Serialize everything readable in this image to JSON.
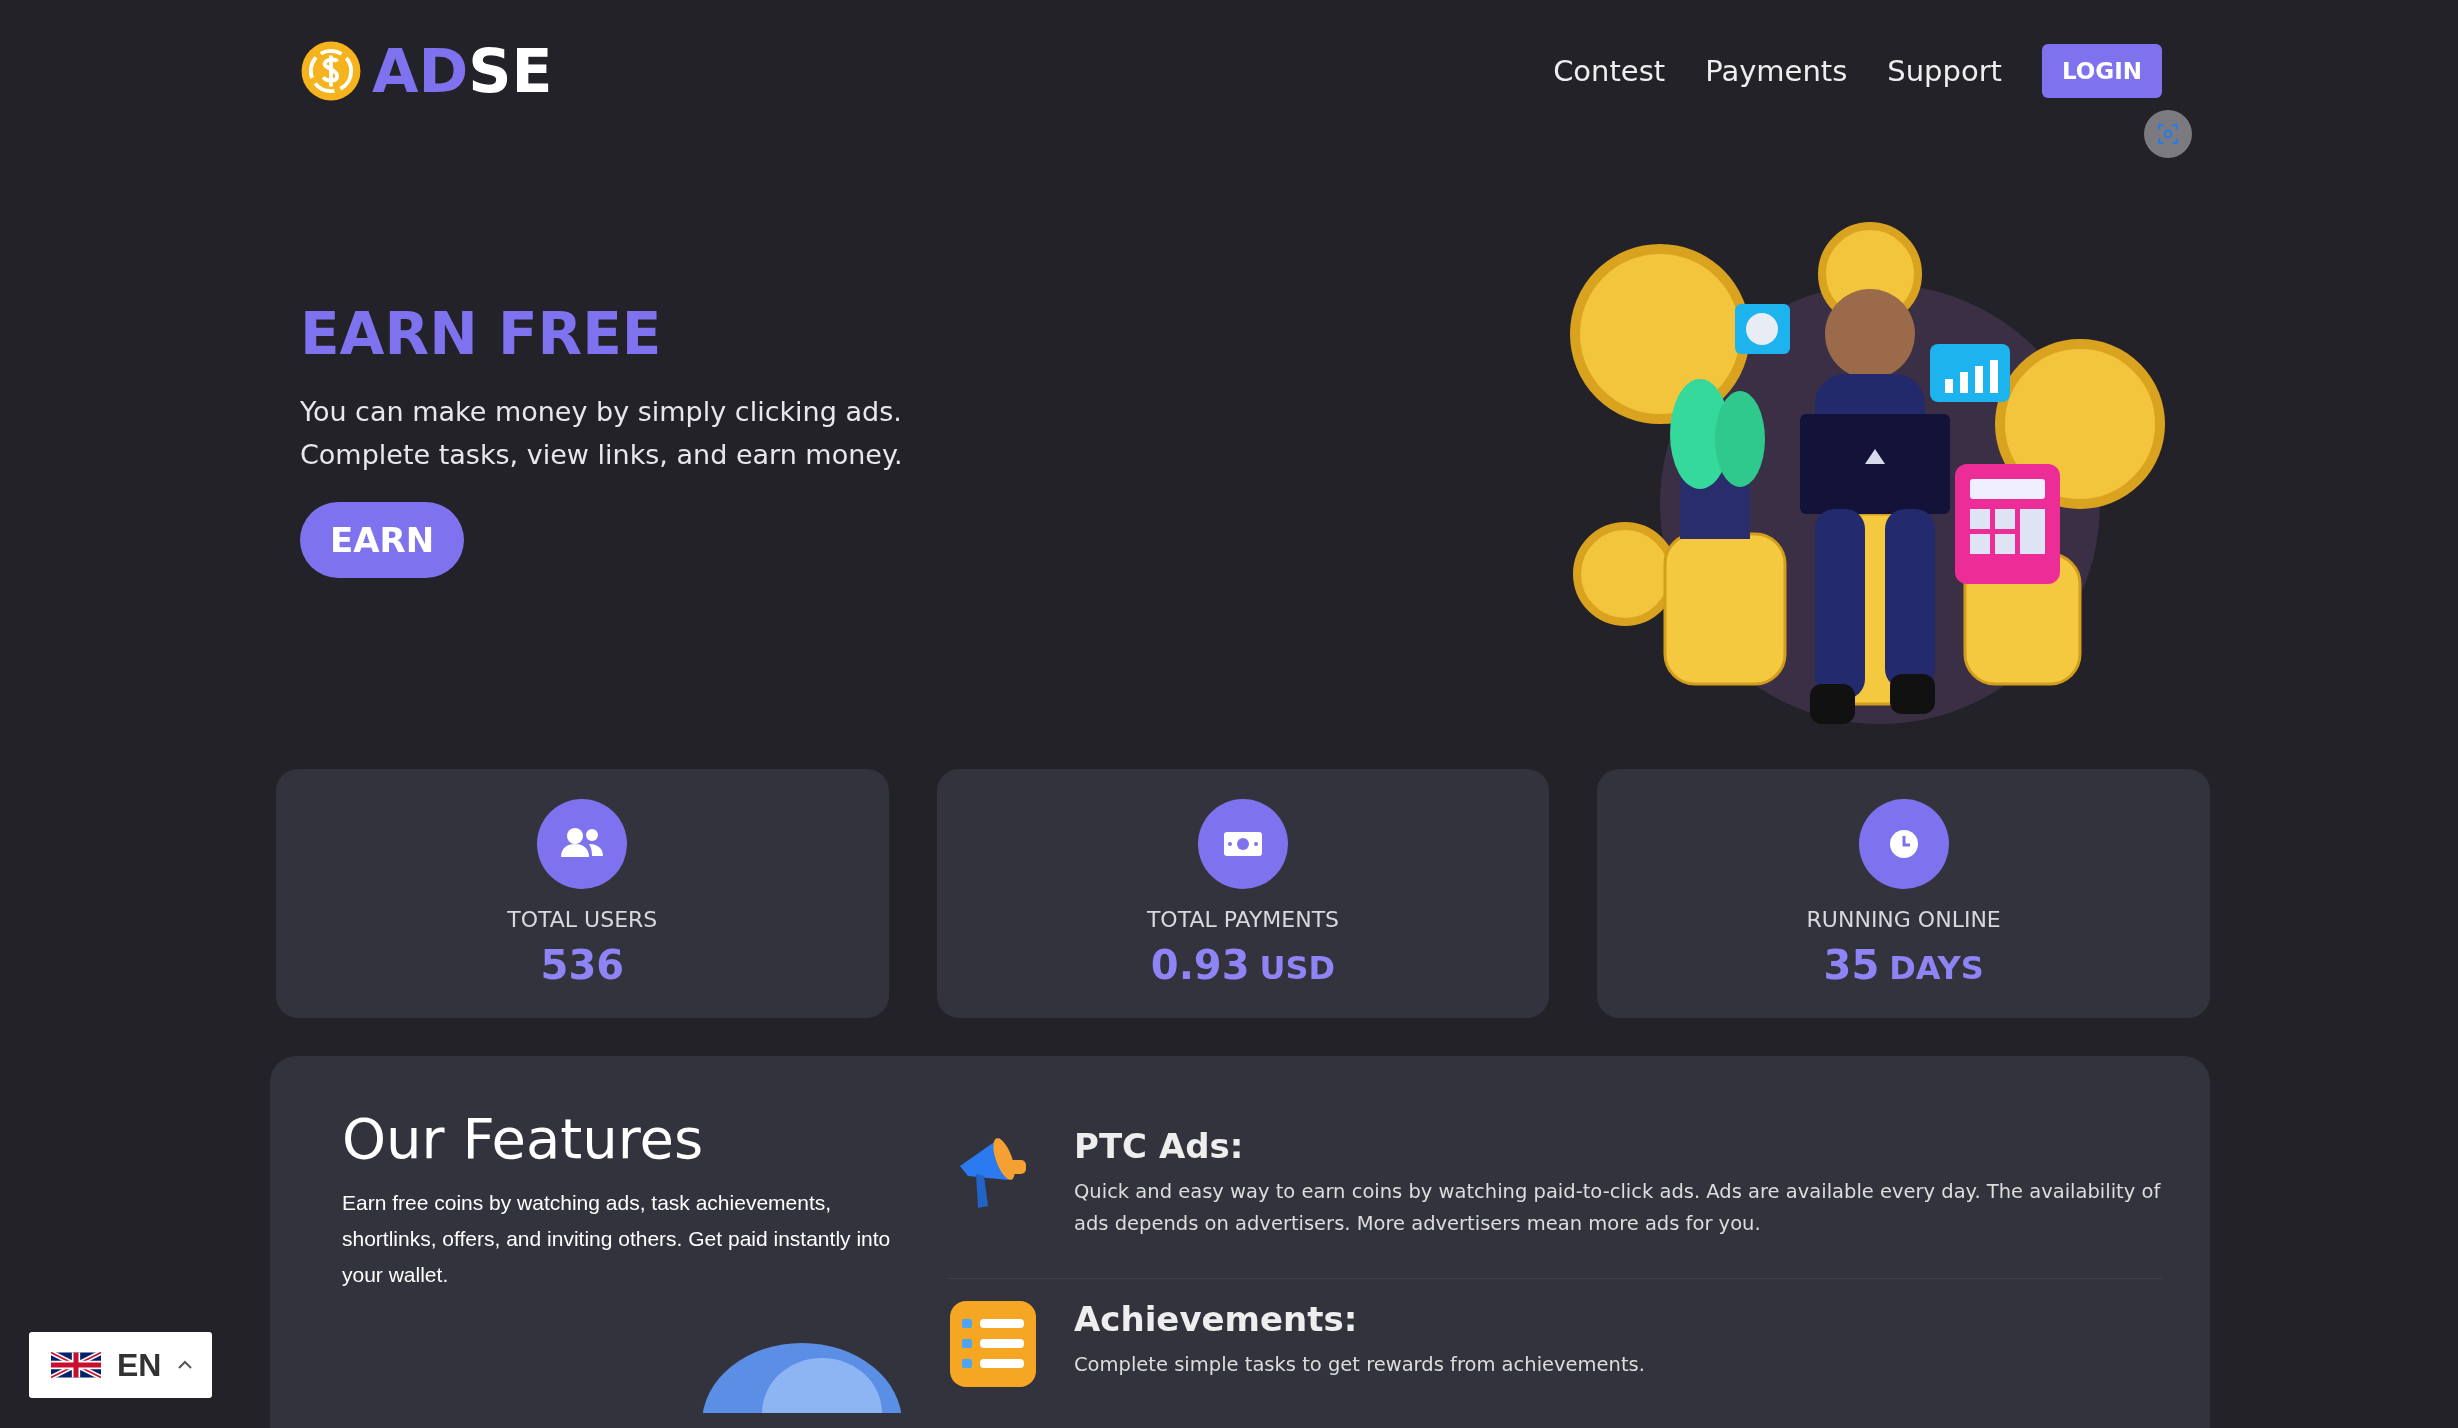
{
  "header": {
    "logo": {
      "accent": "AD",
      "rest": "SE"
    },
    "nav": [
      "Contest",
      "Payments",
      "Support"
    ],
    "login": "LOGIN"
  },
  "hero": {
    "title": "EARN FREE",
    "lines": [
      "You can make money by simply clicking ads.",
      "Complete tasks, view links, and earn money."
    ],
    "button": "EARN"
  },
  "stats": [
    {
      "kind": "users",
      "label": "TOTAL USERS",
      "value": "536"
    },
    {
      "kind": "money",
      "label": "TOTAL PAYMENTS",
      "value": "0.93",
      "unit": "USD"
    },
    {
      "kind": "clock",
      "label": "RUNNING ONLINE",
      "value": "35",
      "unit": "DAYS"
    }
  ],
  "features": {
    "title": "Our Features",
    "text": "Earn free coins by watching ads, task achievements, shortlinks, offers, and inviting others. Get paid instantly into your wallet.",
    "items": [
      {
        "kind": "megaphone",
        "title": "PTC Ads:",
        "text": "Quick and easy way to earn coins by watching paid-to-click ads. Ads are available every day. The availability of ads depends on advertisers. More advertisers mean more ads for you."
      },
      {
        "kind": "checklist",
        "title": "Achievements:",
        "text": "Complete simple tasks to get rewards from achievements."
      }
    ]
  },
  "language": {
    "code": "EN"
  }
}
